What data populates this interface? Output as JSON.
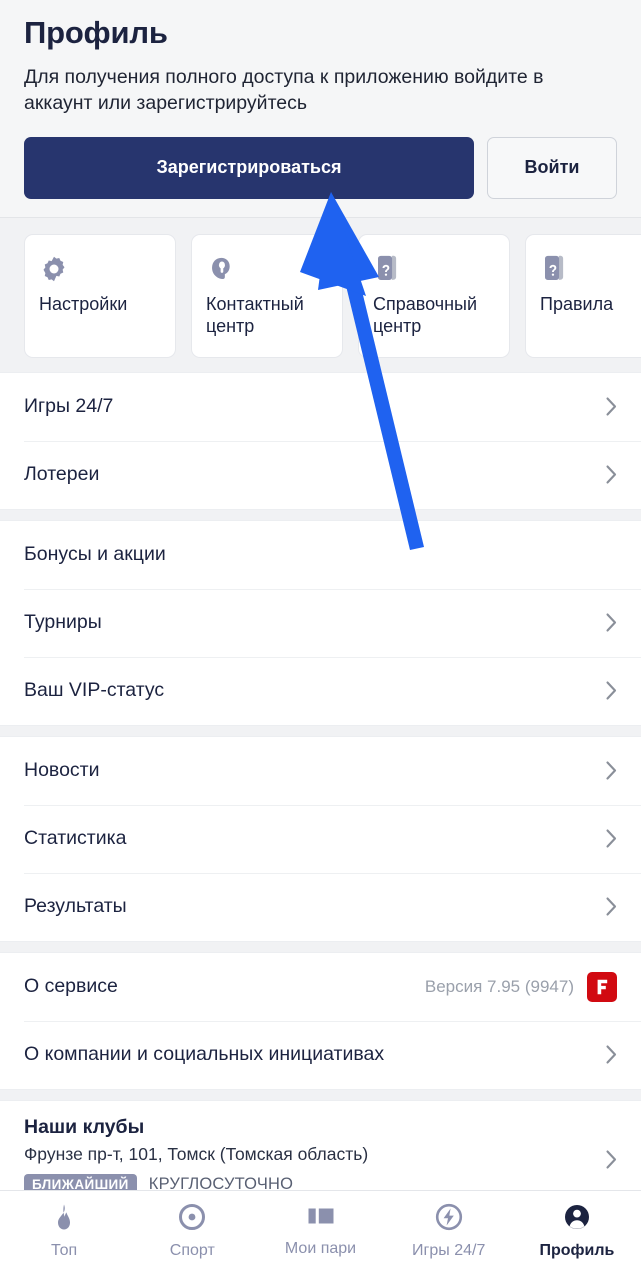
{
  "header": {
    "title": "Профиль",
    "subtitle": "Для получения полного доступа к приложению войдите в аккаунт или зарегистрируйтесь",
    "register_label": "Зарегистрироваться",
    "login_label": "Войти"
  },
  "quick_cards": [
    {
      "label": "Настройки",
      "icon": "gear-icon"
    },
    {
      "label": "Контактный центр",
      "icon": "headset-icon"
    },
    {
      "label": "Справочный центр",
      "icon": "book-question-icon"
    },
    {
      "label": "Правила",
      "icon": "book-question-icon"
    }
  ],
  "groups": [
    {
      "rows": [
        {
          "label": "Игры 24/7",
          "chevron": true
        },
        {
          "label": "Лотереи",
          "chevron": true
        }
      ]
    },
    {
      "rows": [
        {
          "label": "Бонусы и акции",
          "chevron": false
        },
        {
          "label": "Турниры",
          "chevron": true
        },
        {
          "label": "Ваш VIP-статус",
          "chevron": true
        }
      ]
    },
    {
      "rows": [
        {
          "label": "Новости",
          "chevron": true
        },
        {
          "label": "Статистика",
          "chevron": true
        },
        {
          "label": "Результаты",
          "chevron": true
        }
      ]
    }
  ],
  "about": {
    "service_label": "О сервисе",
    "version": "Версия 7.95 (9947)",
    "logo_letter": "F",
    "company_label": "О компании и социальных инициативах"
  },
  "clubs": {
    "title": "Наши клубы",
    "address": "Фрунзе пр-т, 101, Томск (Томская область)",
    "badge": "БЛИЖАЙШИЙ",
    "hours": "КРУГЛОСУТОЧНО"
  },
  "bottom_nav": [
    {
      "label": "Топ",
      "icon": "flame-icon",
      "active": false
    },
    {
      "label": "Спорт",
      "icon": "target-icon",
      "active": false
    },
    {
      "label": "Мои пари",
      "icon": "ticket-icon",
      "active": false
    },
    {
      "label": "Игры 24/7",
      "icon": "bolt-circle-icon",
      "active": false
    },
    {
      "label": "Профиль",
      "icon": "person-icon",
      "active": true
    }
  ],
  "colors": {
    "brand_navy": "#27356e",
    "page_bg": "#f1f2f4",
    "card_bg": "#ffffff",
    "text_primary": "#1c2340",
    "muted": "#8b90ad",
    "logo_red": "#d10a11",
    "annotation_blue": "#1f62f0"
  },
  "annotation": {
    "type": "arrow",
    "points_to": "Зарегистрироваться"
  }
}
